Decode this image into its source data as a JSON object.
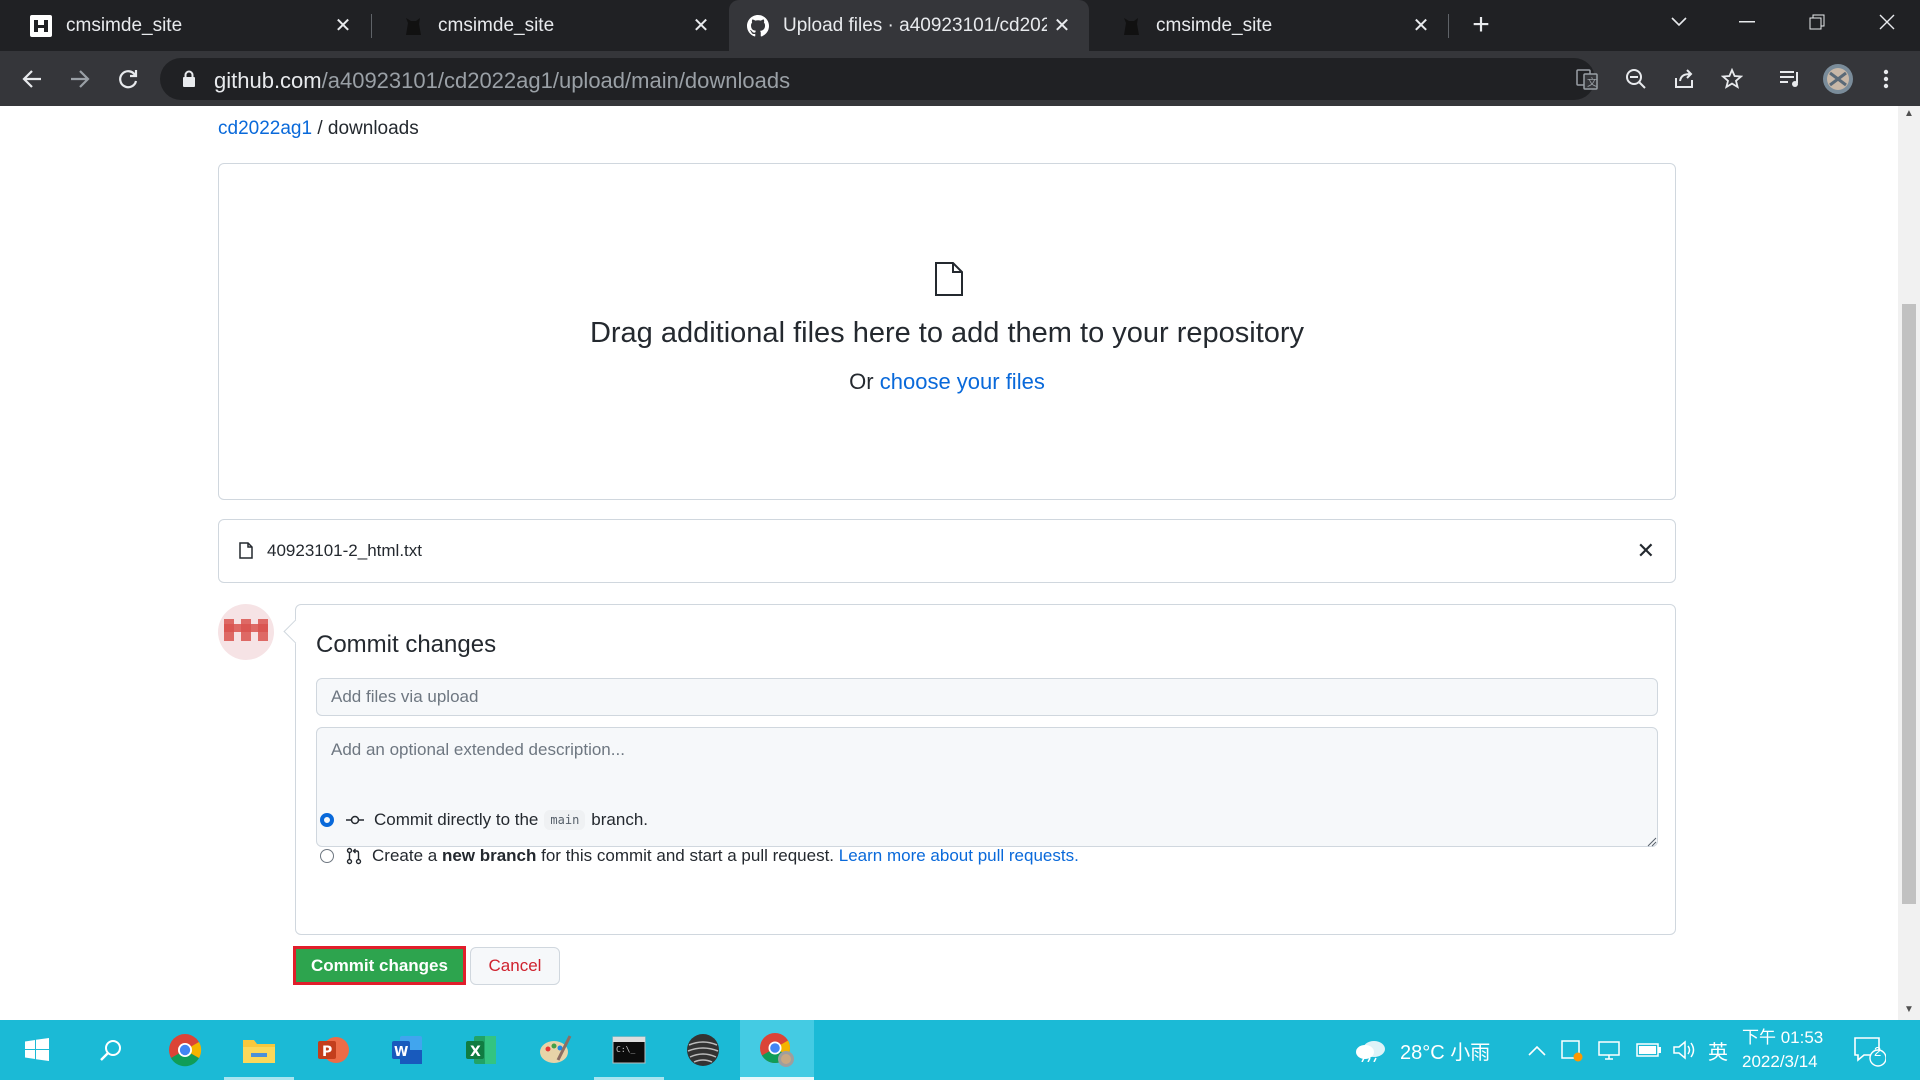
{
  "browser": {
    "tabs": [
      {
        "title": "cmsimde_site",
        "active": false
      },
      {
        "title": "cmsimde_site",
        "active": false
      },
      {
        "title": "Upload files · a40923101/cd2022ag1",
        "active": true
      },
      {
        "title": "cmsimde_site",
        "active": false
      }
    ],
    "url_host": "github.com",
    "url_path": "/a40923101/cd2022ag1/upload/main/downloads"
  },
  "page": {
    "breadcrumb_repo": "cd2022ag1",
    "breadcrumb_sep": " / ",
    "breadcrumb_dir": "downloads",
    "drop_title": "Drag additional files here to add them to your repository",
    "drop_or": "Or ",
    "drop_link": "choose your files",
    "file_name": "40923101-2_html.txt",
    "commit": {
      "heading": "Commit changes",
      "summary_placeholder": "Add files via upload",
      "desc_placeholder": "Add an optional extended description...",
      "opt1_prefix": "Commit directly to the",
      "opt1_branch": "main",
      "opt1_suffix": "branch.",
      "opt2_a": "Create a ",
      "opt2_bold": "new branch",
      "opt2_b": " for this commit and start a pull request. ",
      "opt2_link": "Learn more about pull requests.",
      "commit_button": "Commit changes",
      "cancel_button": "Cancel"
    }
  },
  "taskbar": {
    "weather": "28°C 小雨",
    "ime": "英",
    "time": "下午 01:53",
    "date": "2022/3/14",
    "notifications": "2"
  },
  "colors": {
    "link": "#0969da",
    "commit_green": "#2da44e",
    "highlight_red": "#e01e2b",
    "taskbar": "#1bbad6"
  }
}
